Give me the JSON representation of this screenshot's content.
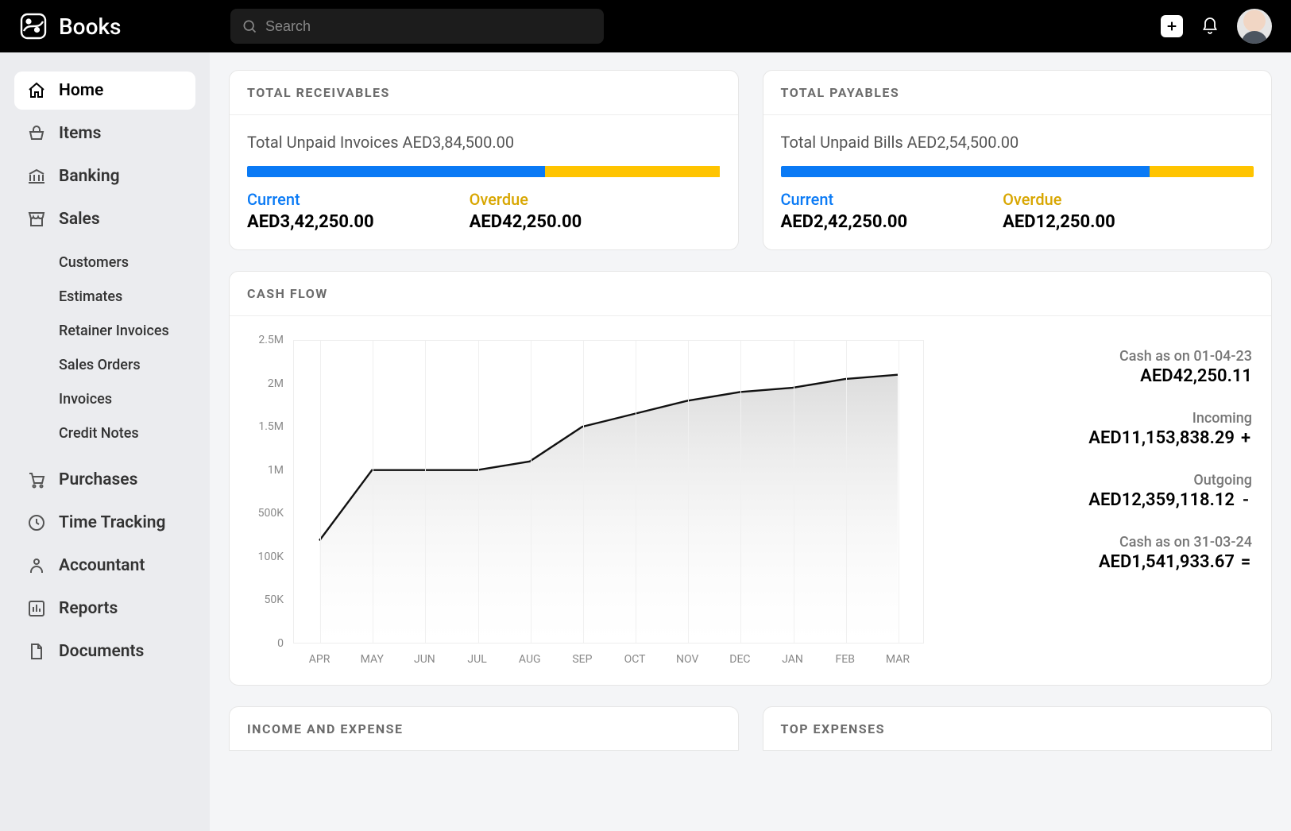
{
  "header": {
    "app_name": "Books",
    "search_placeholder": "Search"
  },
  "sidebar": {
    "items": [
      {
        "icon": "home",
        "label": "Home",
        "active": true,
        "children": []
      },
      {
        "icon": "basket",
        "label": "Items",
        "active": false,
        "children": []
      },
      {
        "icon": "bank",
        "label": "Banking",
        "active": false,
        "children": []
      },
      {
        "icon": "shop",
        "label": "Sales",
        "active": false,
        "children": [
          "Customers",
          "Estimates",
          "Retainer Invoices",
          "Sales Orders",
          "Invoices",
          "Credit Notes"
        ]
      },
      {
        "icon": "cart",
        "label": "Purchases",
        "active": false,
        "children": []
      },
      {
        "icon": "clock",
        "label": "Time Tracking",
        "active": false,
        "children": []
      },
      {
        "icon": "person",
        "label": "Accountant",
        "active": false,
        "children": []
      },
      {
        "icon": "chart",
        "label": "Reports",
        "active": false,
        "children": []
      },
      {
        "icon": "document",
        "label": "Documents",
        "active": false,
        "children": []
      }
    ]
  },
  "receivables": {
    "title": "TOTAL RECEIVABLES",
    "unpaid_line": "Total Unpaid Invoices AED3,84,500.00",
    "current_label": "Current",
    "overdue_label": "Overdue",
    "current_value": "AED3,42,250.00",
    "overdue_value": "AED42,250.00",
    "current_pct": 63,
    "overdue_pct": 37
  },
  "payables": {
    "title": "TOTAL PAYABLES",
    "unpaid_line": "Total Unpaid Bills AED2,54,500.00",
    "current_label": "Current",
    "overdue_label": "Overdue",
    "current_value": "AED2,42,250.00",
    "overdue_value": "AED12,250.00",
    "current_pct": 78,
    "overdue_pct": 22
  },
  "cashflow": {
    "title": "CASH FLOW",
    "stats": [
      {
        "label": "Cash as on 01-04-23",
        "value": "AED42,250.11",
        "sign": ""
      },
      {
        "label": "Incoming",
        "value": "AED11,153,838.29",
        "sign": "+"
      },
      {
        "label": "Outgoing",
        "value": "AED12,359,118.12",
        "sign": "-"
      },
      {
        "label": "Cash as on 31-03-24",
        "value": "AED1,541,933.67",
        "sign": "="
      }
    ]
  },
  "bottom": {
    "income_expense_title": "INCOME AND EXPENSE",
    "top_expenses_title": "TOP EXPENSES"
  },
  "chart_data": {
    "type": "line",
    "title": "CASH FLOW",
    "xlabel": "",
    "ylabel": "",
    "categories": [
      "APR",
      "MAY",
      "JUN",
      "JUL",
      "AUG",
      "SEP",
      "OCT",
      "NOV",
      "DEC",
      "JAN",
      "FEB",
      "MAR"
    ],
    "values": [
      250000,
      1000000,
      1000000,
      1000000,
      1100000,
      1500000,
      1650000,
      1800000,
      1900000,
      1950000,
      2050000,
      2100000
    ],
    "y_ticks": [
      0,
      50000,
      100000,
      500000,
      1000000,
      1500000,
      2000000,
      2500000
    ],
    "y_tick_labels": [
      "0",
      "50K",
      "100K",
      "500K",
      "1M",
      "1.5M",
      "2M",
      "2.5M"
    ],
    "ylim": [
      0,
      2500000
    ]
  }
}
